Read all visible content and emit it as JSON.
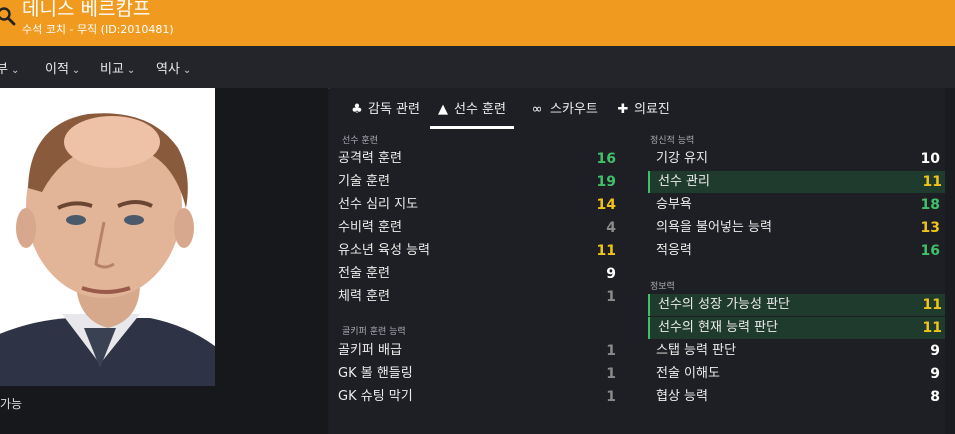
{
  "header": {
    "title": "데니스 베르캄프",
    "subtitle": "수석 코치 - 무직 (ID:2010481)",
    "color": "#f19a20"
  },
  "nav": [
    "부",
    "이적",
    "비교",
    "역사"
  ],
  "caption": "가능",
  "tabs": [
    {
      "label": "감독 관련",
      "icon": "coach-icon"
    },
    {
      "label": "선수 훈련",
      "icon": "training-icon"
    },
    {
      "label": "스카우트",
      "icon": "binoculars-icon"
    },
    {
      "label": "의료진",
      "icon": "medical-icon"
    }
  ],
  "training": {
    "heading": "선수 훈련",
    "rows": [
      {
        "label": "공격력 훈련",
        "value": "16"
      },
      {
        "label": "기술 훈련",
        "value": "19"
      },
      {
        "label": "선수 심리 지도",
        "value": "14"
      },
      {
        "label": "수비력 훈련",
        "value": "4"
      },
      {
        "label": "유소년 육성 능력",
        "value": "11"
      },
      {
        "label": "전술 훈련",
        "value": "9"
      },
      {
        "label": "체력 훈련",
        "value": "1"
      }
    ]
  },
  "goalkeeping": {
    "heading": "골키퍼 훈련 능력",
    "rows": [
      {
        "label": "골키퍼 배급",
        "value": "1"
      },
      {
        "label": "GK 볼 핸들링",
        "value": "1"
      },
      {
        "label": "GK 슈팅 막기",
        "value": "1"
      }
    ]
  },
  "mental": {
    "heading": "정신적 능력",
    "rows": [
      {
        "label": "기강 유지",
        "value": "10"
      },
      {
        "label": "선수 관리",
        "value": "11"
      },
      {
        "label": "승부욕",
        "value": "18"
      },
      {
        "label": "의욕을 불어넣는 능력",
        "value": "13"
      },
      {
        "label": "적응력",
        "value": "16"
      }
    ]
  },
  "knowledge": {
    "heading": "정보력",
    "rows": [
      {
        "label": "선수의 성장 가능성 판단",
        "value": "11"
      },
      {
        "label": "선수의 현재 능력 판단",
        "value": "11"
      },
      {
        "label": "스탭 능력 판단",
        "value": "9"
      },
      {
        "label": "전술 이해도",
        "value": "9"
      },
      {
        "label": "협상 능력",
        "value": "8"
      }
    ]
  },
  "value_colors": {
    "low": "#8a8a8a",
    "mid": "#ffffff",
    "good": "#f0c419",
    "high": "#41c06a"
  }
}
